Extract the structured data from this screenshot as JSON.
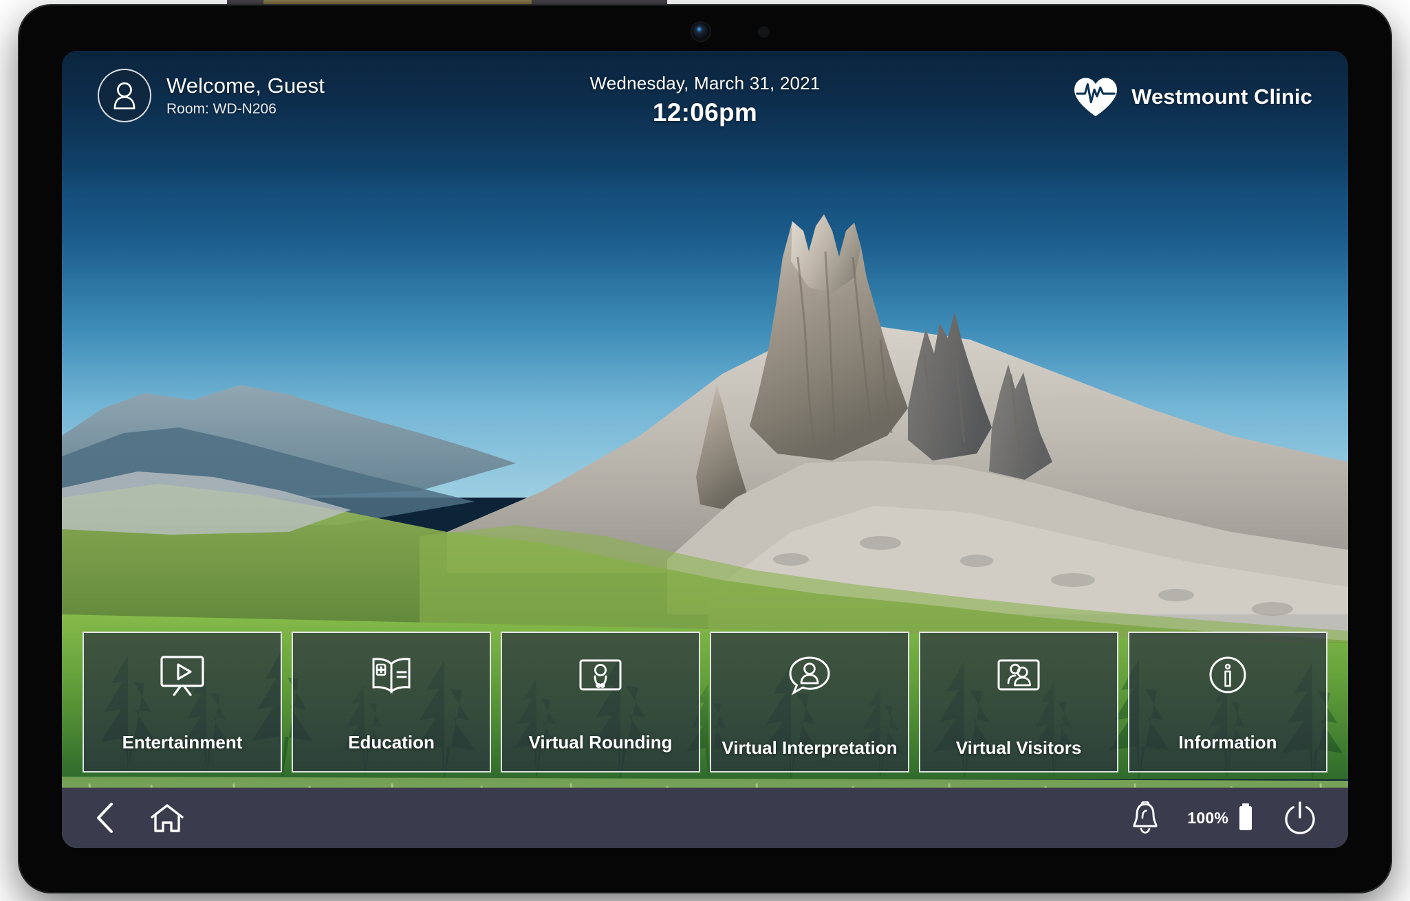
{
  "device": {
    "type": "wall-mounted-patient-tablet",
    "camera_icon": "front-camera-lens",
    "sensor_icon": "ambient-light-sensor"
  },
  "header": {
    "avatar_icon": "user-avatar-icon",
    "welcome_text": "Welcome, Guest",
    "room_text": "Room: WD-N206",
    "date_text": "Wednesday, March 31, 2021",
    "time_text": "12:06pm",
    "brand": {
      "logo_icon": "heart-pulse-icon",
      "name": "Westmount Clinic"
    }
  },
  "tiles": [
    {
      "label": "Entertainment",
      "icon": "tv-play-icon",
      "lines": 1
    },
    {
      "label": "Education",
      "icon": "open-book-medical-icon",
      "lines": 1
    },
    {
      "label": "Virtual Rounding",
      "icon": "screen-doctor-icon",
      "lines": 1
    },
    {
      "label": "Virtual Interpretation",
      "icon": "speech-bubble-person-icon",
      "lines": 2
    },
    {
      "label": "Virtual Visitors",
      "icon": "screen-two-people-icon",
      "lines": 2
    },
    {
      "label": "Information",
      "icon": "info-circle-icon",
      "lines": 1
    }
  ],
  "navbar": {
    "back_icon": "chevron-left-icon",
    "home_icon": "home-icon",
    "notification_icon": "bell-icon",
    "battery_percent": "100%",
    "battery_icon": "battery-full-icon",
    "power_icon": "power-icon"
  },
  "colors": {
    "navbar_bg": "#3a3c4d",
    "tile_bg": "rgba(42,48,62,0.72)",
    "tile_border": "#ffffff",
    "text": "#ffffff",
    "sky_top": "#0e3355",
    "sky_bottom": "#9ecfe2"
  }
}
